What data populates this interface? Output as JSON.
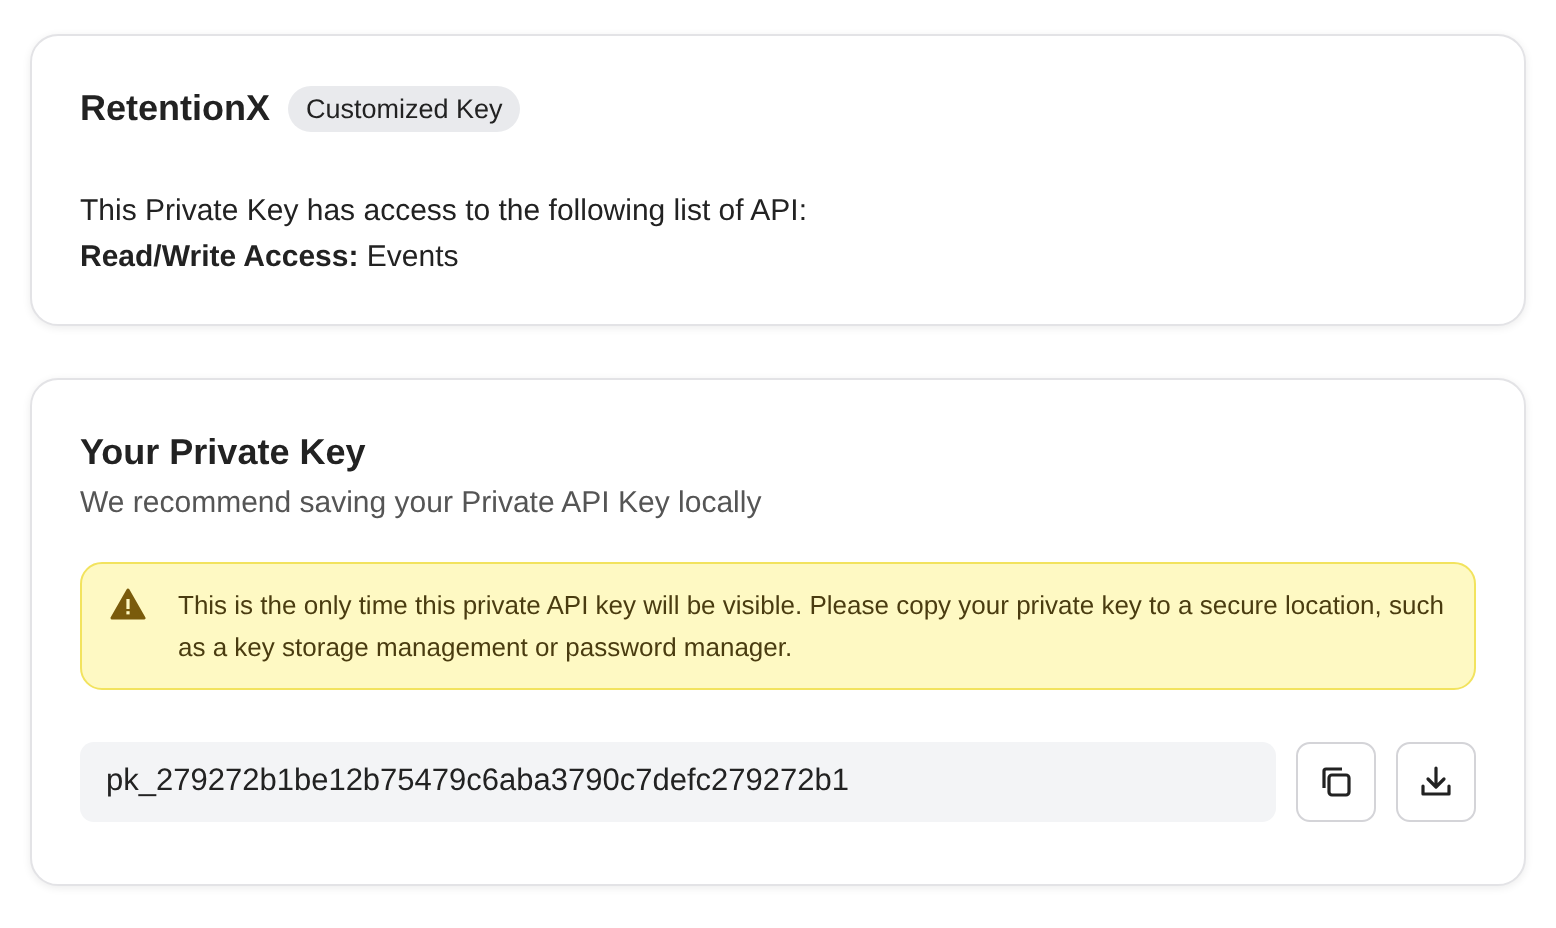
{
  "app_card": {
    "name": "RetentionX",
    "badge": "Customized Key",
    "description": "This Private Key has access to the following list of API:",
    "access": "**Read/Write Access:** Events"
  },
  "key_card": {
    "title": "Your Private Key",
    "subtitle": "We recommend saving your Private API Key locally",
    "warning": "This is the only time this private API key will be visible. Please copy your private key to a secure location, such as a key storage management or password manager.",
    "key_value": "pk_279272b1be12b75479c6aba3790c7defc279272b1"
  }
}
